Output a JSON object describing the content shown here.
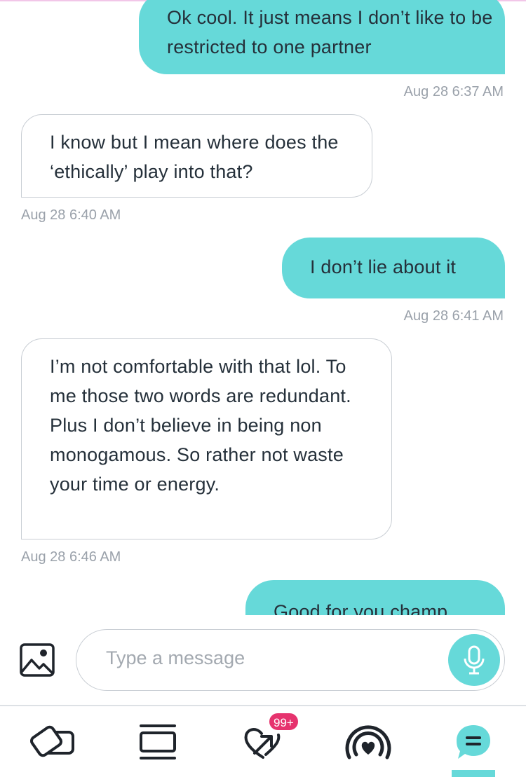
{
  "messages": [
    {
      "id": "m1",
      "direction": "sent",
      "text": "Ok cool. It just means I don’t like to be restricted to one partner",
      "time": "Aug 28 6:37 AM"
    },
    {
      "id": "m2",
      "direction": "received",
      "text": "I know but I mean where does the ‘ethically’ play into that?",
      "time": "Aug 28 6:40 AM"
    },
    {
      "id": "m3",
      "direction": "sent",
      "text": "I don’t lie about it",
      "time": "Aug 28 6:41 AM"
    },
    {
      "id": "m4",
      "direction": "received",
      "text": "I’m not comfortable with that lol. To me those two words are redundant. Plus I don’t believe in being non monogamous. So rather not waste your time or energy.",
      "time": "Aug 28 6:46 AM"
    },
    {
      "id": "m5",
      "direction": "sent",
      "text": "Good for you champ",
      "time": ""
    }
  ],
  "composer": {
    "placeholder": "Type a message",
    "image_icon": "image-icon",
    "mic_icon": "microphone-icon"
  },
  "nav": {
    "items": [
      {
        "id": "discover",
        "icon": "cards-icon"
      },
      {
        "id": "browse",
        "icon": "stack-icon"
      },
      {
        "id": "likes",
        "icon": "heart-arrow-icon",
        "badge": "99+"
      },
      {
        "id": "live",
        "icon": "broadcast-heart-icon"
      },
      {
        "id": "messages",
        "icon": "chat-bubble-icon",
        "active": true
      }
    ]
  },
  "colors": {
    "accent": "#66d9d9",
    "badge": "#e6336e",
    "timestamp": "#9aa1aa"
  }
}
